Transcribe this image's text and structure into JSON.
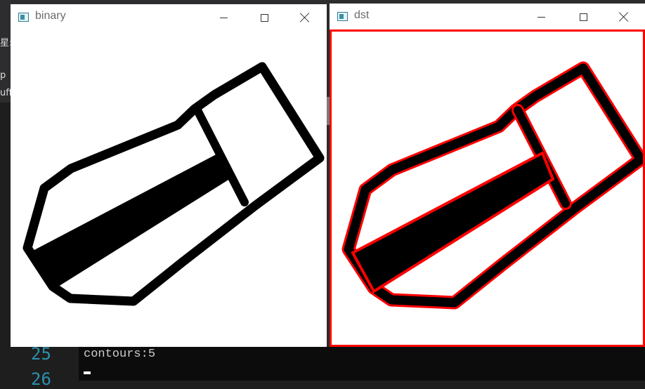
{
  "windows": {
    "binary": {
      "title": "binary",
      "minimize": "minimize",
      "maximize": "maximize",
      "close": "close"
    },
    "dst": {
      "title": "dst",
      "minimize": "minimize",
      "maximize": "maximize",
      "close": "close"
    }
  },
  "background_fragments": {
    "left": [
      "星:",
      "p",
      "uff"
    ]
  },
  "editor": {
    "line_numbers": [
      "25",
      "26"
    ]
  },
  "console": {
    "output": "contours:5"
  },
  "colors": {
    "contour": "#ff0000",
    "shape": "#000000",
    "image_bg": "#ffffff",
    "console_bg": "#0c0c0c",
    "line_number": "#2b91af"
  },
  "icons": [
    "window-app-icon",
    "minimize-icon",
    "maximize-icon",
    "close-icon"
  ]
}
